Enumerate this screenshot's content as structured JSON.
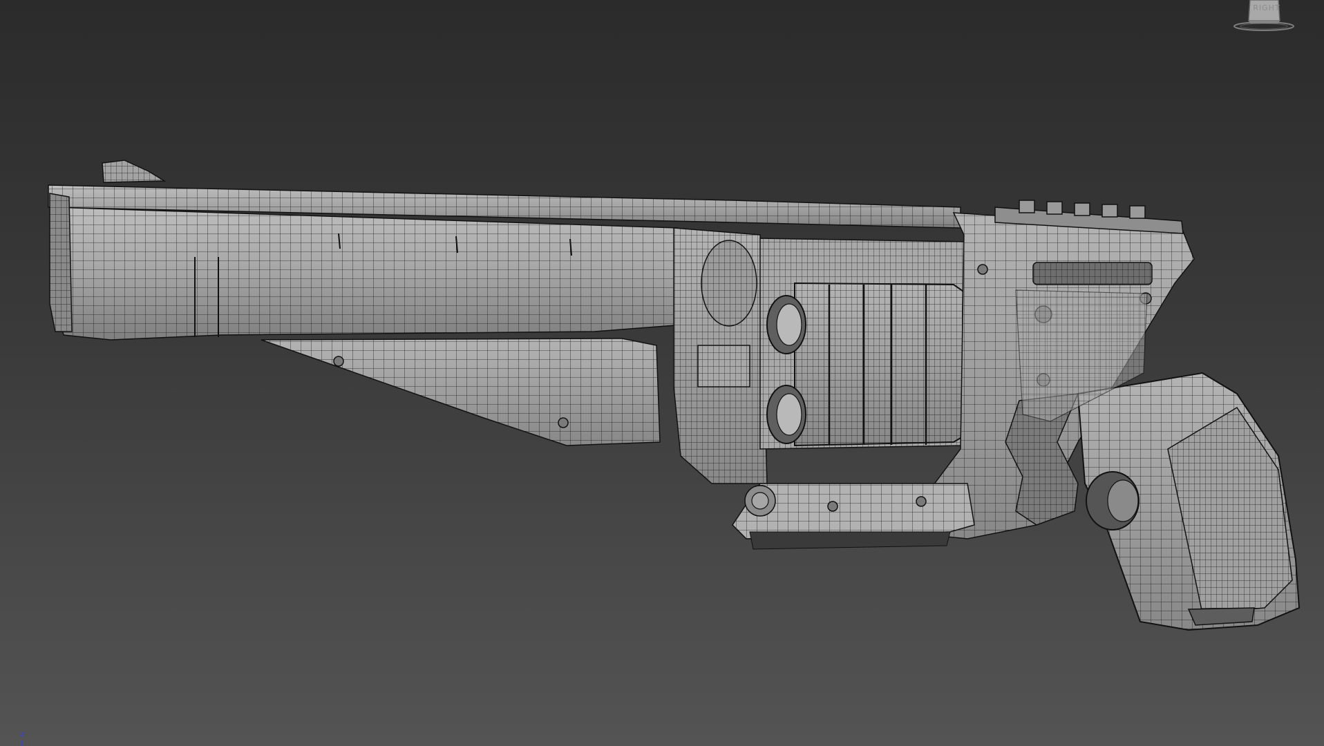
{
  "viewport": {
    "view_cube_label": "RIGHT",
    "axis_label": "z",
    "colors": {
      "background_top": "#2b2b2b",
      "background_bottom": "#545454",
      "model_fill": "#a7a7a7",
      "model_fill_dark": "#8f8f8f",
      "wire_color": "#141414",
      "axis_z": "#2f3dff"
    }
  },
  "model": {
    "name_icon": "revolver-wireframe-mesh",
    "display_mode": "wireframe-on-shaded"
  }
}
